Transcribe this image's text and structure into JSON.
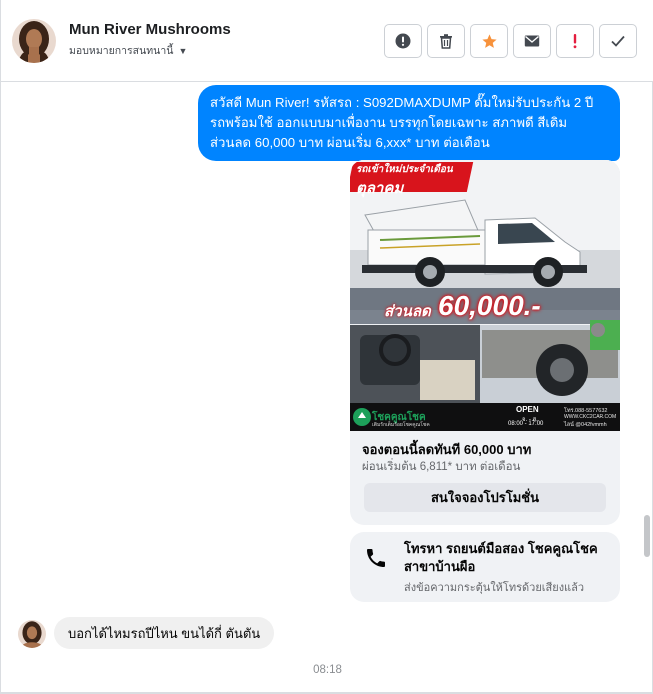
{
  "header": {
    "title": "Mun River Mushrooms",
    "assign_label": "มอบหมายการสนทนานี้",
    "actions": [
      {
        "icon": "alert-circle-icon",
        "label": "report"
      },
      {
        "icon": "trash-icon",
        "label": "delete"
      },
      {
        "icon": "star-icon",
        "label": "star"
      },
      {
        "icon": "envelope-icon",
        "label": "mark unread"
      },
      {
        "icon": "exclamation-icon",
        "label": "spam"
      },
      {
        "icon": "check-icon",
        "label": "done"
      }
    ]
  },
  "messages": {
    "outgoing_text": "สวัสดี Mun River! รหัสรถ : S092DMAXDUMP ดั๊มใหม่รับประกัน 2 ปี รถพร้อมใช้ ออกแบบมาเพื่องาน บรรทุกโดยเฉพาะ สภาพดี สีเดิม ส่วนลด 60,000 บาท  ผ่อนเริ่ม 6,xxx* บาท ต่อเดือน",
    "promo_card": {
      "image_banner_line1": "รถเข้าใหม่ประจำเดือน",
      "image_banner_month": "ตุลาคม",
      "image_discount_label": "ส่วนลด",
      "image_discount_value": "60,000.-",
      "image_brand": "โชคคูณโชค",
      "image_brand_sub": "เติมรักเต็มร้อยโชคคูณโชค",
      "image_open": "OPEN",
      "image_days": "จ. - ส.",
      "image_hours": "08:00 - 17:00",
      "image_tel": "โทร.088-5577632",
      "image_web": "WWW.CKC2CAR.COM",
      "image_line": "ไลน์ @042fvmmh",
      "title": "จองตอนนี้ลดทันที 60,000 บาท",
      "subtitle": "ผ่อนเริ่มต้น 6,811* บาท ต่อเดือน",
      "button": "สนใจจองโปรโมชั่น"
    },
    "call_card": {
      "title": "โทรหา รถยนต์มือสอง โชคคูณโชค สาขาบ้านผือ",
      "subtitle": "ส่งข้อความกระตุ้นให้โทรด้วยเสียงแล้ว"
    },
    "incoming_text": "บอกได้ไหมรถปีไหน ขนได้กี่ ตันตัน",
    "timestamp": "08:18"
  },
  "colors": {
    "brand_blue": "#0084ff",
    "bubble_grey": "#f0f0f0",
    "star_orange": "#f7923b",
    "spam_red": "#e41e3f",
    "promo_red": "#d8141c"
  }
}
